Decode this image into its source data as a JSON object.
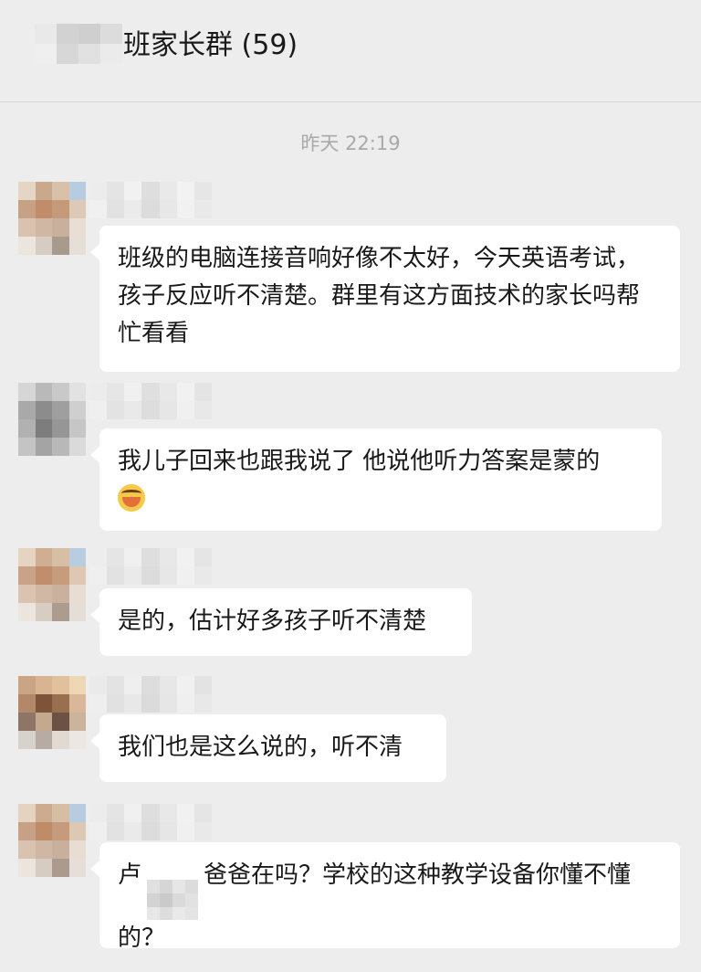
{
  "header": {
    "title": "班家长群 (59)",
    "back_label": "",
    "name_mosaic": [
      "#e9e9e9",
      "#d2d2d2",
      "#cfcfcf",
      "#dcdcdc",
      "#efefef",
      "#d7d7d7",
      "#e1e1e1",
      "#ebebeb"
    ]
  },
  "timestamp": "昨天 22:19",
  "messages": [
    {
      "text": "班级的电脑连接音响好像不太好，今天英语考试，孩子反应听不清楚。群里有这方面技术的家长吗帮忙看看",
      "avatar_mosaic": [
        "#e5d5c5",
        "#c9a88c",
        "#d8c1a8",
        "#b7cce0",
        "#c7a184",
        "#c18c6a",
        "#c49a7b",
        "#ddc9b5",
        "#d9c3b0",
        "#cfb7a3",
        "#c8b09c",
        "#e8ded4",
        "#ebe5de",
        "#d6ccc2",
        "#a89a8d",
        "#e6dfd8"
      ],
      "name_mosaic": [
        "#ececec",
        "#e4e4e4",
        "#f1f1f1",
        "#dedede",
        "#e9e9e9",
        "#f2f2f2",
        "#e6e6e6",
        "#f0f0f0",
        "#e2e2e2",
        "#ebebeb",
        "#dcdcdc",
        "#e7e7e7",
        "#f1f1f1",
        "#e9e9e9"
      ]
    },
    {
      "text": "我儿子回来也跟我说了 他说他听力答案是蒙的",
      "emoji": "tears-of-joy-emoji",
      "avatar_mosaic": [
        "#d6d6d6",
        "#b9b9b9",
        "#c9c9c9",
        "#e2e2e2",
        "#a9a9a9",
        "#8c8c8c",
        "#9f9f9f",
        "#cfcfcf",
        "#b1b1b1",
        "#7d7d7d",
        "#969696",
        "#c6c6c6",
        "#c4c4c4",
        "#a4a4a4",
        "#b8b8b8",
        "#dadada"
      ],
      "name_mosaic": [
        "#ececec",
        "#e6e6e6",
        "#f0f0f0",
        "#dfdfdf",
        "#e8e8e8",
        "#f1f1f1",
        "#e4e4e4",
        "#efefef",
        "#e3e3e3",
        "#e9e9e9",
        "#dddddd",
        "#e6e6e6",
        "#f0f0f0",
        "#e8e8e8"
      ]
    },
    {
      "text": "是的，估计好多孩子听不清楚",
      "avatar_mosaic": [
        "#e6d4c2",
        "#cfae92",
        "#d7bfa5",
        "#b9cde1",
        "#c8a387",
        "#c08e6c",
        "#c69c7d",
        "#dec8b3",
        "#dac4b1",
        "#d0b8a4",
        "#cab19d",
        "#e7ddd3",
        "#ece5de",
        "#d7cdc3",
        "#ab9c8f",
        "#e5ded7"
      ],
      "name_mosaic": [
        "#ededed",
        "#e5e5e5",
        "#f0f0f0",
        "#dedede",
        "#e8e8e8",
        "#f1f1f1",
        "#e5e5e5",
        "#efefef",
        "#e2e2e2",
        "#eaeaea",
        "#dcdcdc",
        "#e7e7e7",
        "#f0f0f0",
        "#e9e9e9"
      ]
    },
    {
      "text": "我们也是这么说的，听不清",
      "avatar_mosaic": [
        "#caa585",
        "#d8b493",
        "#e1c19c",
        "#edd7b4",
        "#b38769",
        "#7d5439",
        "#9a6f50",
        "#d8b899",
        "#8f7565",
        "#c4a98e",
        "#6b5244",
        "#cbb39c",
        "#d8d2cc",
        "#b6aca3",
        "#e2dad2",
        "#ece7e2"
      ],
      "name_mosaic": [
        "#eaeaea",
        "#e3e3e3",
        "#efefef",
        "#dddddd",
        "#e7e7e7",
        "#f0f0f0",
        "#e3e3e3",
        "#eeeeee",
        "#e1e1e1",
        "#e8e8e8",
        "#dbdbdb",
        "#e6e6e6",
        "#efefef",
        "#e8e8e8"
      ]
    },
    {
      "prefix": "卢",
      "suffix": "爸爸在吗？学校的这种教学设备你懂不懂的？",
      "avatar_mosaic": [
        "#e4d3c1",
        "#ccab8f",
        "#d6bea4",
        "#b8cce0",
        "#c6a185",
        "#bf8c6a",
        "#c59b7c",
        "#ddc8b3",
        "#d9c3b0",
        "#cfb7a3",
        "#c9b09c",
        "#e7ddd3",
        "#ebe5de",
        "#d6ccc2",
        "#aa9b8e",
        "#e6dfd8"
      ],
      "name_mosaic": [
        "#ececec",
        "#e4e4e4",
        "#f0f0f0",
        "#dedede",
        "#e8e8e8",
        "#f1f1f1",
        "#e5e5e5",
        "#efefef",
        "#e2e2e2",
        "#eaeaea",
        "#dcdcdc",
        "#e6e6e6",
        "#f0f0f0",
        "#e9e9e9"
      ],
      "inline_mosaic": [
        "#e0e0e0",
        "#d6d6d6",
        "#e6e6e6",
        "#dcdcdc",
        "#d3d3d3",
        "#cacaca",
        "#dadada",
        "#e2e2e2",
        "#e7e7e7",
        "#dddddd",
        "#e9e9e9",
        "#e4e4e4"
      ]
    }
  ]
}
